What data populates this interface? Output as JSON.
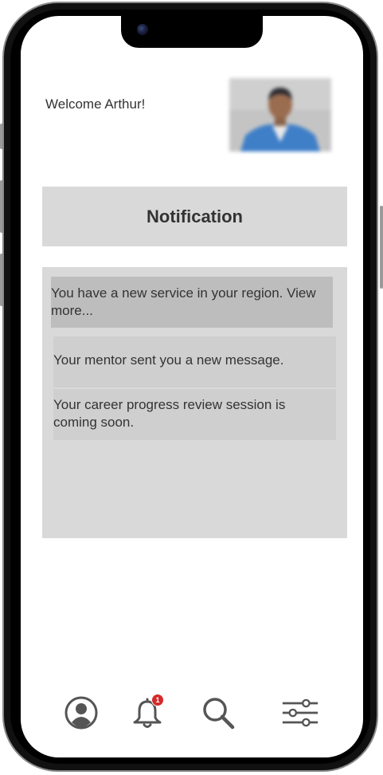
{
  "welcome": {
    "text": "Welcome Arthur!"
  },
  "profile": {
    "avatar_icon": "user-photo"
  },
  "notifications": {
    "title": "Notification",
    "items": [
      {
        "text": "You have a new service in your region. View more...",
        "background": "#bdbdbd"
      },
      {
        "text": "Your mentor sent you a new message.",
        "background": "#cfcfcf"
      },
      {
        "text": "Your career progress review session is coming soon.",
        "background": "#cfcfcf"
      }
    ]
  },
  "nav": {
    "items": [
      {
        "name": "profile",
        "icon": "user-circle-icon"
      },
      {
        "name": "notifications",
        "icon": "bell-icon",
        "badge": "1"
      },
      {
        "name": "search",
        "icon": "search-icon"
      },
      {
        "name": "settings",
        "icon": "sliders-icon"
      }
    ]
  },
  "colors": {
    "panel": "#d9d9d9",
    "highlight": "#bdbdbd",
    "item": "#cfcfcf",
    "text": "#333333",
    "badge": "#d42a2a",
    "icon": "#555555"
  }
}
